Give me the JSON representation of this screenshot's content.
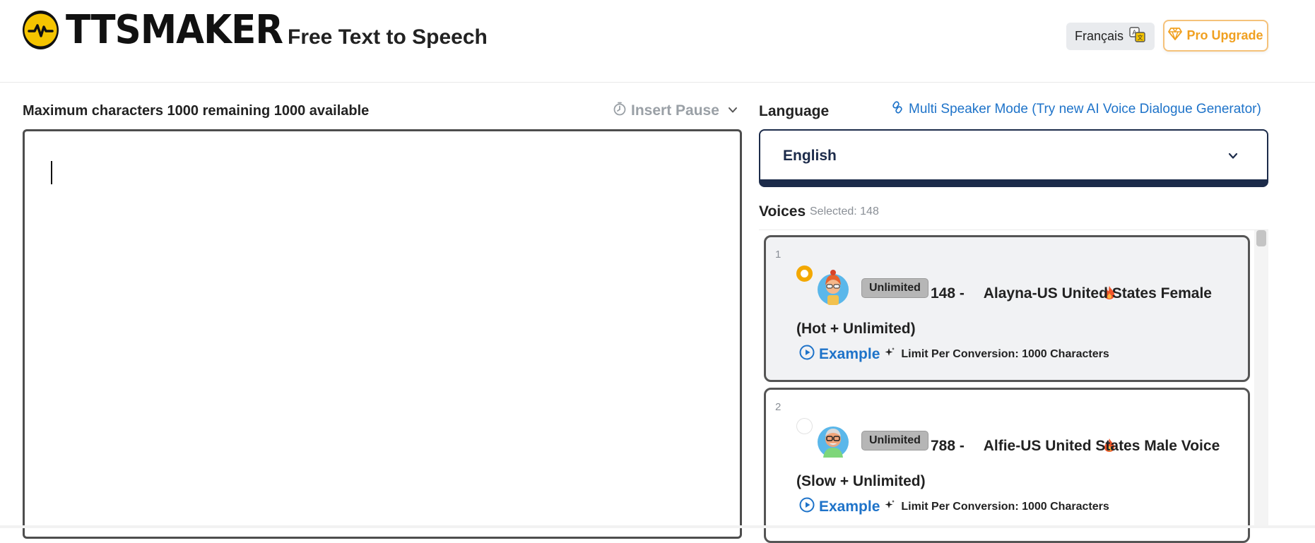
{
  "header": {
    "logo_text": "TTSMAKER",
    "tagline": "Free Text to Speech",
    "language_button": "Français",
    "pro_button": "Pro Upgrade"
  },
  "editor": {
    "char_info": "Maximum characters 1000 remaining 1000 available",
    "insert_pause": "Insert Pause",
    "text": ""
  },
  "language": {
    "label": "Language",
    "multi_speaker_link": "Multi Speaker Mode (Try new AI Voice Dialogue Generator)",
    "selected": "English"
  },
  "voices": {
    "label": "Voices",
    "selected_count": "Selected: 148",
    "items": [
      {
        "index": "1",
        "badge": "Unlimited",
        "id_prefix": "148 -",
        "name": "Alayna-US United States Female (Hot + Unlimited)",
        "example_label": "Example",
        "limit": "Limit Per Conversion: 1000 Characters",
        "selected": true
      },
      {
        "index": "2",
        "badge": "Unlimited",
        "id_prefix": "788 -",
        "name": "Alfie-US United States Male Voice (Slow + Unlimited)",
        "example_label": "Example",
        "limit": "Limit Per Conversion: 1000 Characters",
        "selected": false
      }
    ]
  },
  "colors": {
    "accent_blue": "#1e73c9",
    "pro_orange": "#f0a020",
    "selected_radio": "#f3a800",
    "navy": "#1c2b4a"
  },
  "icons": {
    "logo": "waveform-circle-icon",
    "language_button": "translate-icon",
    "pro_button": "diamond-icon",
    "insert_pause": "timer-icon",
    "multi_speaker": "link-icon",
    "select": "chevron-down-icon",
    "example": "play-circle-icon",
    "limit": "sparkle-icon",
    "hot": "fire-icon"
  }
}
